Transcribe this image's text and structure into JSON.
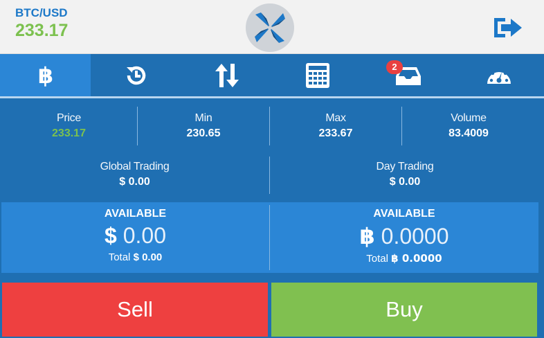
{
  "header": {
    "pair": "BTC/USD",
    "price": "233.17"
  },
  "tabs": [
    {
      "name": "bitcoin",
      "active": true
    },
    {
      "name": "history"
    },
    {
      "name": "transfer"
    },
    {
      "name": "calculator"
    },
    {
      "name": "inbox",
      "badge": "2"
    },
    {
      "name": "dashboard"
    }
  ],
  "stats": {
    "price_label": "Price",
    "price_value": "233.17",
    "min_label": "Min",
    "min_value": "230.65",
    "max_label": "Max",
    "max_value": "233.67",
    "volume_label": "Volume",
    "volume_value": "83.4009",
    "global_label": "Global Trading",
    "global_value": "$ 0.00",
    "day_label": "Day Trading",
    "day_value": "$ 0.00"
  },
  "available": {
    "usd": {
      "title": "AVAILABLE",
      "symbol": "$",
      "amount": "0.00",
      "total_label": "Total",
      "total_value": "$ 0.00"
    },
    "btc": {
      "title": "AVAILABLE",
      "symbol": "฿",
      "amount": "0.0000",
      "total_label": "Total",
      "total_value": "฿ 0.0000"
    }
  },
  "actions": {
    "sell": "Sell",
    "buy": "Buy"
  },
  "colors": {
    "accent": "#1c78c8",
    "positive": "#7cc14f",
    "sell": "#ee4040",
    "buy": "#80c050"
  }
}
